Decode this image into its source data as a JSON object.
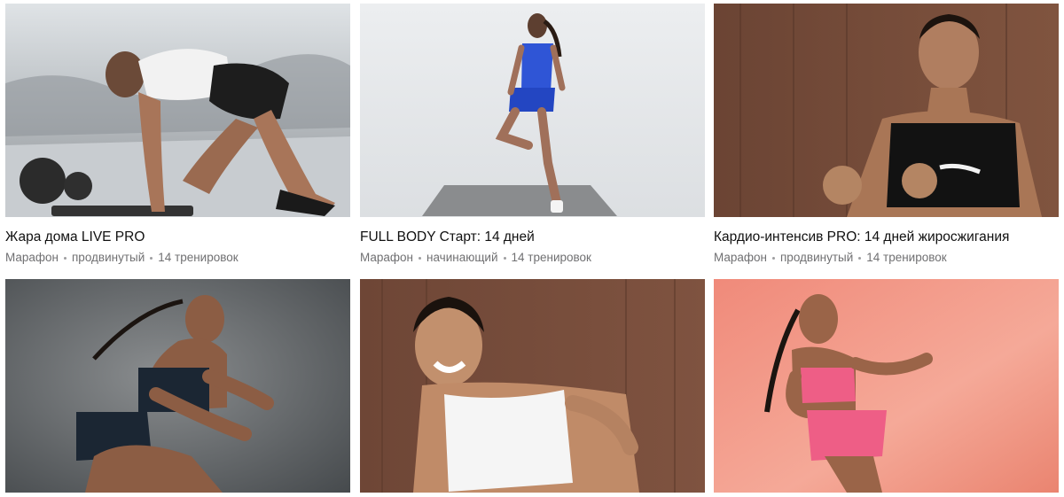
{
  "programs": [
    {
      "title": "Жара дома LIVE PRO",
      "meta": [
        "Марафон",
        "продвинутый",
        "14 тренировок"
      ],
      "image": "woman-mountain-climber-home-gym"
    },
    {
      "title": "FULL BODY Старт: 14 дней",
      "meta": [
        "Марафон",
        "начинающий",
        "14 тренировок"
      ],
      "image": "woman-standing-on-one-leg-on-mat"
    },
    {
      "title": "Кардио-интенсив PRO: 14 дней жиросжигания",
      "meta": [
        "Марафон",
        "продвинутый",
        "14 тренировок"
      ],
      "image": "woman-boxing-pose-wood-background"
    },
    {
      "title": "",
      "meta": [],
      "image": "woman-squat-jump-grey-background"
    },
    {
      "title": "",
      "meta": [],
      "image": "woman-laughing-white-top-wood-background"
    },
    {
      "title": "",
      "meta": [],
      "image": "woman-running-pink-background"
    }
  ]
}
